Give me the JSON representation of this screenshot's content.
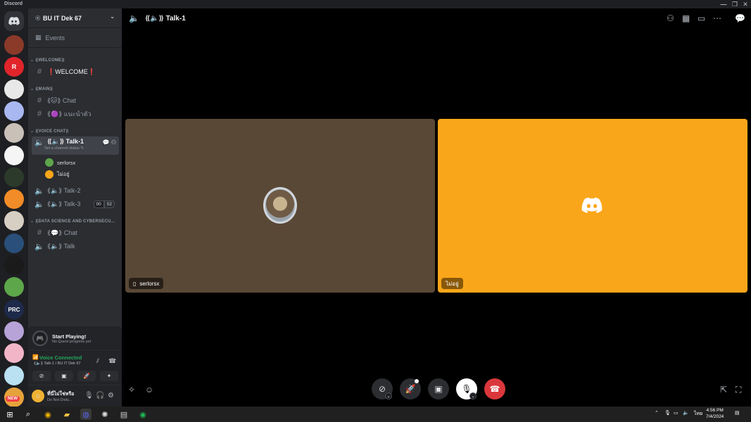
{
  "window": {
    "app_title": "Discord",
    "controls": [
      "—",
      "❐",
      "✕"
    ]
  },
  "server_rail": {
    "home_icon": "discord-icon",
    "new_badge": "NEW",
    "servers": [
      {
        "name": "server-avatar-1",
        "color": "#8b3a2a",
        "label": ""
      },
      {
        "name": "server-roblox",
        "color": "#e1252b",
        "label": "R"
      },
      {
        "name": "server-bu-esports",
        "color": "#e8e8e8",
        "label": ""
      },
      {
        "name": "server-lit",
        "color": "#a9b8f0",
        "label": ""
      },
      {
        "name": "server-anime-1",
        "color": "#c9c0b8",
        "label": ""
      },
      {
        "name": "server-wonder",
        "color": "#f5f5f5",
        "label": ""
      },
      {
        "name": "server-bu-it",
        "color": "#2b3a2b",
        "label": ""
      },
      {
        "name": "server-city",
        "color": "#f28c28",
        "label": ""
      },
      {
        "name": "server-anime-2",
        "color": "#d8cfc4",
        "label": ""
      },
      {
        "name": "server-night",
        "color": "#2a4f7a",
        "label": ""
      },
      {
        "name": "server-stack",
        "color": "#1a1a1a",
        "label": ""
      },
      {
        "name": "server-green",
        "color": "#5da64a",
        "label": ""
      },
      {
        "name": "server-prc",
        "color": "#1e2a4a",
        "label": "PRC"
      },
      {
        "name": "server-purple",
        "color": "#b7a3d8",
        "label": ""
      },
      {
        "name": "server-pink",
        "color": "#f2b5c8",
        "label": ""
      },
      {
        "name": "server-blue",
        "color": "#b9e1f2",
        "label": ""
      },
      {
        "name": "server-new",
        "color": "#e6a23c",
        "label": ""
      }
    ]
  },
  "sidebar": {
    "guild_name": "BU IT Dek 67",
    "events_label": "Events",
    "categories": [
      {
        "label": "⟪WELCOME⟫"
      },
      {
        "label": "⟪MAIN⟫"
      },
      {
        "label": "⟪VOICE CHAT⟫"
      },
      {
        "label": "⟪DATA SCIENCE AND CYBERSECU..."
      }
    ],
    "channels": {
      "welcome": "❗WELCOME❗",
      "chat": "⟪🐱⟫ Chat",
      "intro": "⟪🟣⟫ แนะนำตัว",
      "talk1": "⟪🔈⟫ Talk-1",
      "talk1_status": "Set a channel status ✎",
      "talk2": "⟪🔈⟫ Talk-2",
      "talk3": "⟪🔈⟫ Talk-3",
      "talk3_count_a": "00",
      "talk3_count_b": "02",
      "ds_chat": "⟪💬⟫ Chat",
      "ds_talk": "⟪🔈⟫ Talk"
    },
    "voice_users": [
      {
        "name": "serlorsx",
        "color": "#5da64a"
      },
      {
        "name": "ไม่อยู่",
        "color": "#faa61a"
      }
    ],
    "quest": {
      "title": "Start Playing!",
      "subtitle": "No Quest progress yet"
    },
    "voice": {
      "status": "Voice Connected",
      "location": "⟪🔈⟫ Talk-1 / BU IT Dek 67"
    },
    "user": {
      "name": "ที่นี่ไม่ใช่หรือ",
      "status": "Do Not Distu..."
    }
  },
  "main": {
    "channel_title": "⟪🔈⟫ Talk-1",
    "tiles": [
      {
        "name_tag": "serlorsx",
        "color": "#5a4836"
      },
      {
        "name_tag": "ไม่อยู่",
        "color": "#faa61a"
      }
    ]
  },
  "taskbar": {
    "time": "4:56 PM",
    "date": "7/4/2024",
    "lang": "ไทย"
  },
  "colors": {
    "accent_green": "#23a55a",
    "hangup_red": "#da373c",
    "tile_orange": "#faa61a"
  }
}
